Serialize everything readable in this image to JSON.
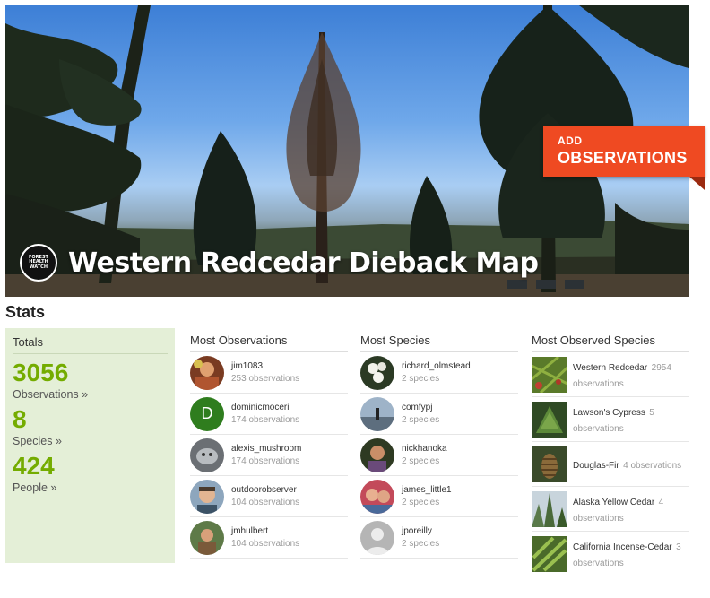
{
  "hero": {
    "title": "Western Redcedar Dieback Map",
    "logo_text": [
      "FOREST",
      "HEALTH",
      "WATCH"
    ],
    "add_button": {
      "line1": "ADD",
      "line2": "OBSERVATIONS",
      "color": "#ef4a22"
    }
  },
  "stats": {
    "heading": "Stats",
    "totals": {
      "title": "Totals",
      "observations": {
        "value": "3056",
        "label": "Observations »"
      },
      "species": {
        "value": "8",
        "label": "Species »"
      },
      "people": {
        "value": "424",
        "label": "People »"
      },
      "accent_color": "#74ac00"
    },
    "most_observations": {
      "title": "Most Observations",
      "items": [
        {
          "name": "jim1083",
          "sub": "253 observations"
        },
        {
          "name": "dominicmoceri",
          "sub": "174 observations",
          "initial": "D"
        },
        {
          "name": "alexis_mushroom",
          "sub": "174 observations"
        },
        {
          "name": "outdoorobserver",
          "sub": "104 observations"
        },
        {
          "name": "jmhulbert",
          "sub": "104 observations"
        }
      ]
    },
    "most_species": {
      "title": "Most Species",
      "items": [
        {
          "name": "richard_olmstead",
          "sub": "2 species"
        },
        {
          "name": "comfypj",
          "sub": "2 species"
        },
        {
          "name": "nickhanoka",
          "sub": "2 species"
        },
        {
          "name": "james_little1",
          "sub": "2 species"
        },
        {
          "name": "jporeilly",
          "sub": "2 species"
        }
      ]
    },
    "most_observed_species": {
      "title": "Most Observed Species",
      "items": [
        {
          "name": "Western Redcedar",
          "sub": "2954 observations"
        },
        {
          "name": "Lawson's Cypress",
          "sub": "5 observations"
        },
        {
          "name": "Douglas-Fir",
          "sub": "4 observations"
        },
        {
          "name": "Alaska Yellow Cedar",
          "sub": "4 observations"
        },
        {
          "name": "California Incense-Cedar",
          "sub": "3 observations"
        }
      ]
    }
  }
}
